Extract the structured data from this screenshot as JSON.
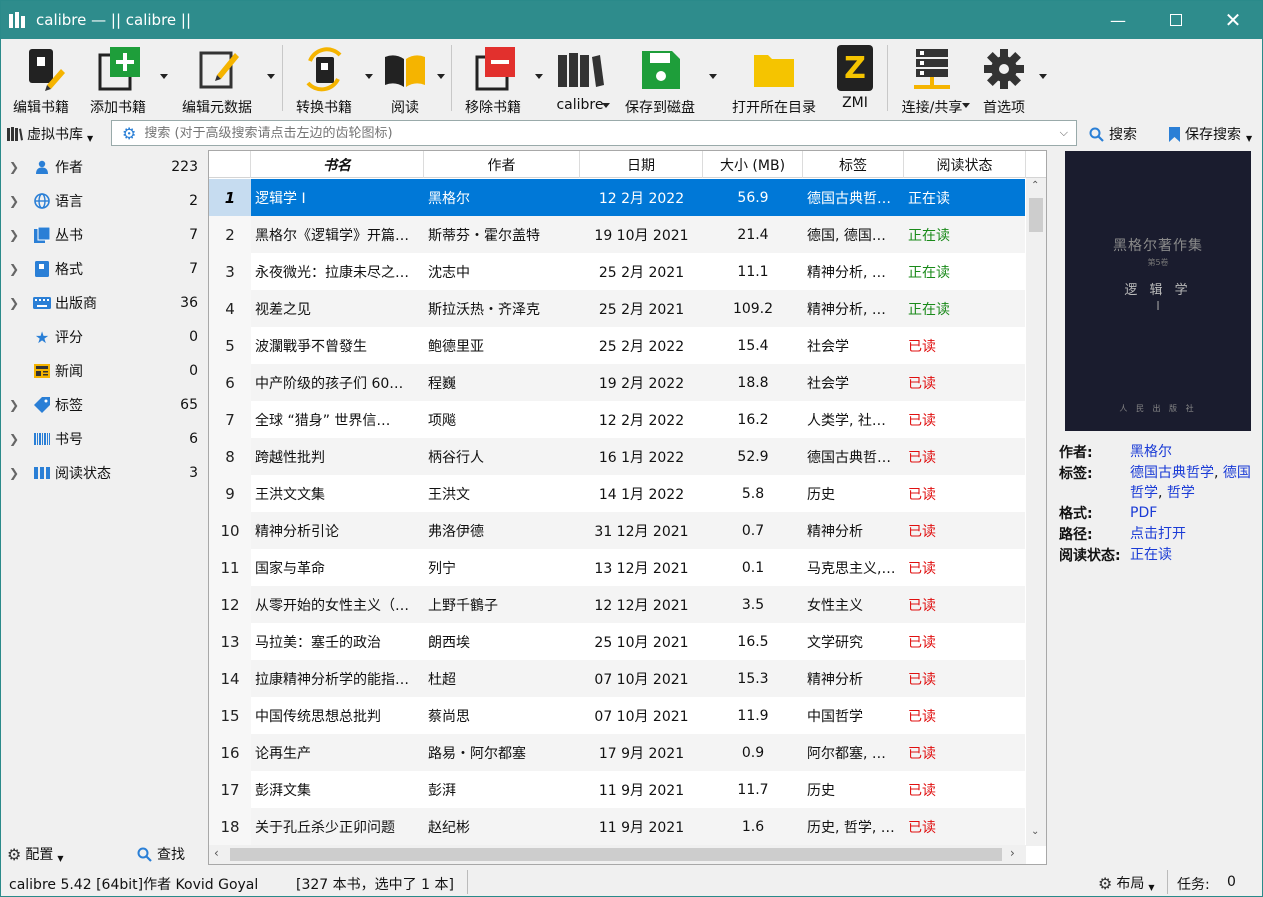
{
  "window": {
    "title": "calibre — || calibre ||"
  },
  "toolbar": {
    "items": [
      {
        "label": "编辑书籍"
      },
      {
        "label": "添加书籍"
      },
      {
        "label": "编辑元数据"
      },
      {
        "label": "转换书籍"
      },
      {
        "label": "阅读"
      },
      {
        "label": "移除书籍"
      },
      {
        "label": "calibre"
      },
      {
        "label": "保存到磁盘"
      },
      {
        "label": "打开所在目录"
      },
      {
        "label": "ZMI"
      },
      {
        "label": "连接/共享"
      },
      {
        "label": "首选项"
      }
    ],
    "zmi_letter": "Z"
  },
  "search": {
    "virtual_library": "虚拟书库",
    "placeholder": "搜索 (对于高级搜索请点击左边的齿轮图标)",
    "search_button": "搜索",
    "save_search": "保存搜索"
  },
  "tag_browser": {
    "categories": [
      {
        "name": "作者",
        "count": "223"
      },
      {
        "name": "语言",
        "count": "2"
      },
      {
        "name": "丛书",
        "count": "7"
      },
      {
        "name": "格式",
        "count": "7"
      },
      {
        "name": "出版商",
        "count": "36"
      },
      {
        "name": "评分",
        "count": "0"
      },
      {
        "name": "新闻",
        "count": "0"
      },
      {
        "name": "标签",
        "count": "65"
      },
      {
        "name": "书号",
        "count": "6"
      },
      {
        "name": "阅读状态",
        "count": "3"
      }
    ],
    "configure": "配置",
    "find": "查找"
  },
  "table": {
    "columns": [
      "书名",
      "作者",
      "日期",
      "大小 (MB)",
      "标签",
      "阅读状态"
    ],
    "rows": [
      {
        "n": "1",
        "title": "逻辑学 I",
        "author": "黑格尔",
        "date": "12 2月 2022",
        "size": "56.9",
        "tags": "德国古典哲…",
        "status": "正在读",
        "state": "reading"
      },
      {
        "n": "2",
        "title": "黑格尔《逻辑学》开篇…",
        "author": "斯蒂芬・霍尔盖特",
        "date": "19 10月 2021",
        "size": "21.4",
        "tags": "德国, 德国…",
        "status": "正在读",
        "state": "reading"
      },
      {
        "n": "3",
        "title": "永夜微光：拉康未尽之…",
        "author": "沈志中",
        "date": "25 2月 2021",
        "size": "11.1",
        "tags": "精神分析, …",
        "status": "正在读",
        "state": "reading"
      },
      {
        "n": "4",
        "title": "视差之见",
        "author": "斯拉沃热・齐泽克",
        "date": "25 2月 2021",
        "size": "109.2",
        "tags": "精神分析, …",
        "status": "正在读",
        "state": "reading"
      },
      {
        "n": "5",
        "title": "波瀾戰爭不曾發生",
        "author": "鲍德里亚",
        "date": "25 2月 2022",
        "size": "15.4",
        "tags": "社会学",
        "status": "已读",
        "state": "done"
      },
      {
        "n": "6",
        "title": "中产阶级的孩子们 60…",
        "author": "程巍",
        "date": "19 2月 2022",
        "size": "18.8",
        "tags": "社会学",
        "status": "已读",
        "state": "done"
      },
      {
        "n": "7",
        "title": "全球 “猎身” 世界信…",
        "author": "项飚",
        "date": "12 2月 2022",
        "size": "16.2",
        "tags": "人类学, 社…",
        "status": "已读",
        "state": "done"
      },
      {
        "n": "8",
        "title": "跨越性批判",
        "author": "柄谷行人",
        "date": "16 1月 2022",
        "size": "52.9",
        "tags": "德国古典哲…",
        "status": "已读",
        "state": "done"
      },
      {
        "n": "9",
        "title": "王洪文文集",
        "author": "王洪文",
        "date": "14 1月 2022",
        "size": "5.8",
        "tags": "历史",
        "status": "已读",
        "state": "done"
      },
      {
        "n": "10",
        "title": "精神分析引论",
        "author": "弗洛伊德",
        "date": "31 12月 2021",
        "size": "0.7",
        "tags": "精神分析",
        "status": "已读",
        "state": "done"
      },
      {
        "n": "11",
        "title": "国家与革命",
        "author": "列宁",
        "date": "13 12月 2021",
        "size": "0.1",
        "tags": "马克思主义,…",
        "status": "已读",
        "state": "done"
      },
      {
        "n": "12",
        "title": "从零开始的女性主义（…",
        "author": "上野千鶴子",
        "date": "12 12月 2021",
        "size": "3.5",
        "tags": "女性主义",
        "status": "已读",
        "state": "done"
      },
      {
        "n": "13",
        "title": "马拉美：塞壬的政治",
        "author": "朗西埃",
        "date": "25 10月 2021",
        "size": "16.5",
        "tags": "文学研究",
        "status": "已读",
        "state": "done"
      },
      {
        "n": "14",
        "title": "拉康精神分析学的能指…",
        "author": "杜超",
        "date": "07 10月 2021",
        "size": "15.3",
        "tags": "精神分析",
        "status": "已读",
        "state": "done"
      },
      {
        "n": "15",
        "title": "中国传统思想总批判",
        "author": "蔡尚思",
        "date": "07 10月 2021",
        "size": "11.9",
        "tags": "中国哲学",
        "status": "已读",
        "state": "done"
      },
      {
        "n": "16",
        "title": "论再生产",
        "author": "路易・阿尔都塞",
        "date": "17 9月 2021",
        "size": "0.9",
        "tags": "阿尔都塞, …",
        "status": "已读",
        "state": "done"
      },
      {
        "n": "17",
        "title": "彭湃文集",
        "author": "彭湃",
        "date": "11 9月 2021",
        "size": "11.7",
        "tags": "历史",
        "status": "已读",
        "state": "done"
      },
      {
        "n": "18",
        "title": "关于孔丘杀少正卯问题",
        "author": "赵纪彬",
        "date": "11 9月 2021",
        "size": "1.6",
        "tags": "历史, 哲学, …",
        "status": "已读",
        "state": "done"
      }
    ]
  },
  "book_details": {
    "cover": {
      "series_title": "黑格尔著作集",
      "volume": "第5卷",
      "title": "逻 辑 学",
      "numeral": "I",
      "publisher": "人 民 出 版 社"
    },
    "labels": {
      "author": "作者:",
      "tags": "标签:",
      "formats": "格式:",
      "path": "路径:",
      "read_status": "阅读状态:"
    },
    "author": "黑格尔",
    "tag1": "德国古典哲学",
    "tag2": "德国哲学",
    "tag3": "哲学",
    "formats": "PDF",
    "path": "点击打开",
    "read_status": "正在读"
  },
  "status_bar": {
    "version": "calibre 5.42 [64bit]作者 Kovid Goyal",
    "selection": "[327 本书，选中了 1 本]",
    "layout": "布局",
    "jobs_label": "任务:",
    "jobs_count": "0"
  },
  "colors": {
    "titlebar": "#2e8c8c",
    "selection": "#0078d7",
    "reading": "#1a8a1a",
    "read": "#e01010",
    "link": "#1a3bd6"
  }
}
